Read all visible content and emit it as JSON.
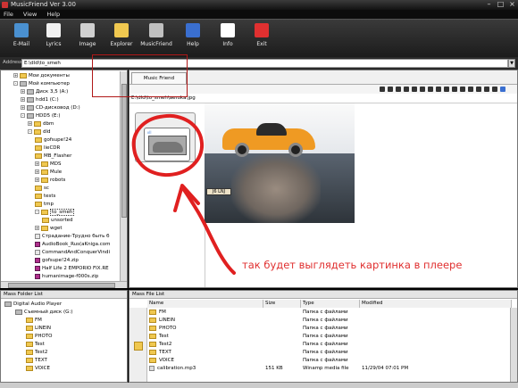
{
  "window": {
    "title": "MusicFriend Ver 3.00"
  },
  "menu": [
    "File",
    "View",
    "Help"
  ],
  "toolbar": {
    "buttons": [
      {
        "label": "E-Mail",
        "icon": "email-icon",
        "color": "#4a90d0"
      },
      {
        "label": "Lyrics",
        "icon": "lyrics-icon",
        "color": "#f0f0f0"
      },
      {
        "label": "Image",
        "icon": "image-icon",
        "color": "#d0d0d0"
      },
      {
        "label": "Explorer",
        "icon": "explorer-icon",
        "color": "#f0c850"
      },
      {
        "label": "MusicFriend",
        "icon": "musicfriend-icon",
        "color": "#c0c0c0"
      },
      {
        "label": "Help",
        "icon": "help-icon",
        "color": "#3a6fd0"
      },
      {
        "label": "Info",
        "icon": "info-icon",
        "color": "#ffffff"
      },
      {
        "label": "Exit",
        "icon": "exit-icon",
        "color": "#e03030"
      }
    ]
  },
  "address": {
    "label": "Address",
    "value": "E:\\dld\\to_smeh"
  },
  "tree": [
    {
      "text": "Мои документы",
      "icon": "folder",
      "level": 1,
      "exp": "+"
    },
    {
      "text": "Мой компьютер",
      "icon": "drive",
      "level": 1,
      "exp": "-"
    },
    {
      "text": "Диск 3,5 (A:)",
      "icon": "drive",
      "level": 2,
      "exp": "+"
    },
    {
      "text": "hdd1 (C:)",
      "icon": "drive",
      "level": 2,
      "exp": "+"
    },
    {
      "text": "CD-дисковод (D:)",
      "icon": "drive",
      "level": 2,
      "exp": "+"
    },
    {
      "text": "HDD5 (E:)",
      "icon": "drive",
      "level": 2,
      "exp": "-"
    },
    {
      "text": "dbm",
      "icon": "folder",
      "level": 3,
      "exp": "+"
    },
    {
      "text": "dld",
      "icon": "folder",
      "level": 3,
      "exp": "-"
    },
    {
      "text": "gofsupe!24",
      "icon": "folder",
      "level": 4,
      "exp": ""
    },
    {
      "text": "lieCDR",
      "icon": "folder",
      "level": 4,
      "exp": ""
    },
    {
      "text": "MB_Flasher",
      "icon": "folder",
      "level": 4,
      "exp": ""
    },
    {
      "text": "MDS",
      "icon": "folder",
      "level": 4,
      "exp": "+"
    },
    {
      "text": "Mule",
      "icon": "folder",
      "level": 4,
      "exp": "+"
    },
    {
      "text": "robots",
      "icon": "folder",
      "level": 4,
      "exp": "+"
    },
    {
      "text": "sc",
      "icon": "folder",
      "level": 4,
      "exp": ""
    },
    {
      "text": "tests",
      "icon": "folder",
      "level": 4,
      "exp": ""
    },
    {
      "text": "tmp",
      "icon": "folder",
      "level": 4,
      "exp": ""
    },
    {
      "text": "to_smeh",
      "icon": "folder",
      "level": 4,
      "exp": "-",
      "selected": true
    },
    {
      "text": "unsorted",
      "icon": "folder",
      "level": 5,
      "exp": ""
    },
    {
      "text": "wget",
      "icon": "folder",
      "level": 4,
      "exp": "+"
    },
    {
      "text": "Страдание-Трудно быть б",
      "icon": "file",
      "level": 4,
      "exp": ""
    },
    {
      "text": "AudioBook_Rus(aKniga.com",
      "icon": "zip",
      "level": 4,
      "exp": ""
    },
    {
      "text": "CommandAndConquerVindi",
      "icon": "file",
      "level": 4,
      "exp": ""
    },
    {
      "text": "gofsupe!24.zip",
      "icon": "zip",
      "level": 4,
      "exp": ""
    },
    {
      "text": "Half Life 2 EMPORIO FIX.RE",
      "icon": "zip",
      "level": 4,
      "exp": ""
    },
    {
      "text": "humanimage-f000s.zip",
      "icon": "zip",
      "level": 4,
      "exp": ""
    }
  ],
  "tab": {
    "label": "Music Friend"
  },
  "path": "E:\\dld\\to_smeh\\aeroka.jpg",
  "preview": {
    "plate": "J6 LNJ"
  },
  "annotation": {
    "text": "так будет выглядеть картинка в плеере",
    "color": "#e03030"
  },
  "mass_folder_list": {
    "header": "Mass Folder List",
    "items": [
      {
        "text": "Digital Audio Player",
        "level": 0,
        "icon": "player"
      },
      {
        "text": "Съемный диск (G:)",
        "level": 1,
        "icon": "drive"
      },
      {
        "text": "FM",
        "level": 2,
        "icon": "folder"
      },
      {
        "text": "LINEIN",
        "level": 2,
        "icon": "folder"
      },
      {
        "text": "PHOTO",
        "level": 2,
        "icon": "folder"
      },
      {
        "text": "Test",
        "level": 2,
        "icon": "folder"
      },
      {
        "text": "Test2",
        "level": 2,
        "icon": "folder"
      },
      {
        "text": "TEXT",
        "level": 2,
        "icon": "folder"
      },
      {
        "text": "VOICE",
        "level": 2,
        "icon": "folder"
      }
    ]
  },
  "mass_file_list": {
    "header": "Mass File List",
    "columns": [
      "Name",
      "Size",
      "Type",
      "Modified"
    ],
    "rows": [
      {
        "name": "FM",
        "size": "",
        "type": "Папка с файлами",
        "modified": "",
        "icon": "folder"
      },
      {
        "name": "LINEIN",
        "size": "",
        "type": "Папка с файлами",
        "modified": "",
        "icon": "folder"
      },
      {
        "name": "PHOTO",
        "size": "",
        "type": "Папка с файлами",
        "modified": "",
        "icon": "folder"
      },
      {
        "name": "Test",
        "size": "",
        "type": "Папка с файлами",
        "modified": "",
        "icon": "folder"
      },
      {
        "name": "Test2",
        "size": "",
        "type": "Папка с файлами",
        "modified": "",
        "icon": "folder"
      },
      {
        "name": "TEXT",
        "size": "",
        "type": "Папка с файлами",
        "modified": "",
        "icon": "folder"
      },
      {
        "name": "VOICE",
        "size": "",
        "type": "Папка с файлами",
        "modified": "",
        "icon": "folder"
      },
      {
        "name": "calibration.mp3",
        "size": "151 KB",
        "type": "Winamp media file",
        "modified": "11/29/04 07:01 PM",
        "icon": "file"
      }
    ]
  }
}
